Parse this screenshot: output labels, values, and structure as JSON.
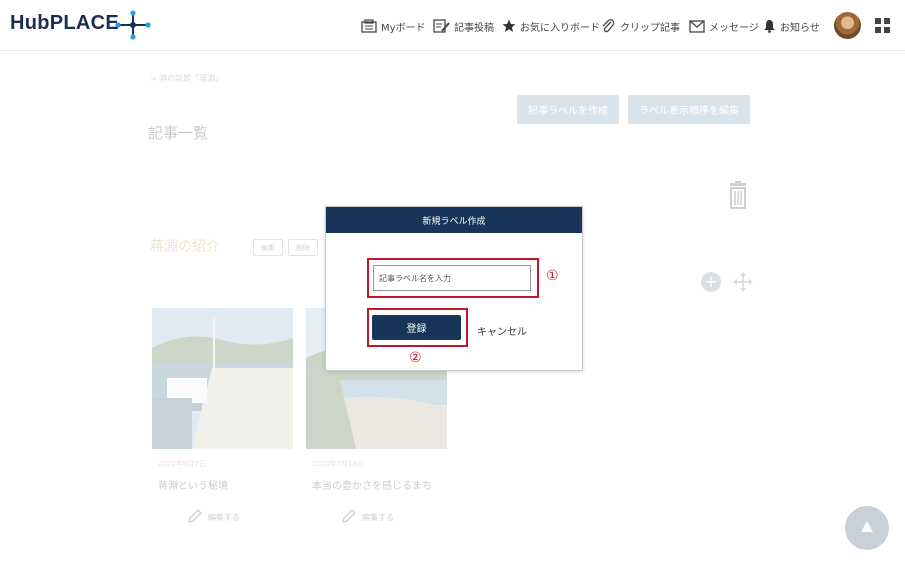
{
  "header": {
    "logo": "HubPLACE",
    "nav": [
      {
        "label": "Myボード",
        "icon": "board-icon"
      },
      {
        "label": "記事投稿",
        "icon": "post-icon"
      },
      {
        "label": "お気に入りボード",
        "icon": "star-icon"
      },
      {
        "label": "クリップ記事",
        "icon": "clip-icon"
      },
      {
        "label": "メッセージ",
        "icon": "mail-icon"
      },
      {
        "label": "お知らせ",
        "icon": "bell-icon"
      }
    ]
  },
  "page": {
    "breadcrumb": "> 港の話題「蒋淵」",
    "create_label_button": "記事ラベルを作成",
    "edit_order_button": "ラベル表示順序を編集",
    "title": "記事一覧",
    "section_title": "蒋淵の紹介",
    "section_edit": "編集",
    "section_delete": "削除",
    "cards": [
      {
        "date": "2020年6月7日",
        "title": "蒋淵という秘境",
        "edit": "編集する"
      },
      {
        "date": "2020年7月18日",
        "title": "本当の豊かさを感じるまち",
        "edit": "編集する"
      }
    ]
  },
  "modal": {
    "title": "新規ラベル作成",
    "input_placeholder": "記事ラベル名を入力",
    "register_button": "登録",
    "cancel": "キャンセル"
  },
  "annotations": {
    "step1": "①",
    "step2": "②",
    "color": "#c0182a"
  }
}
